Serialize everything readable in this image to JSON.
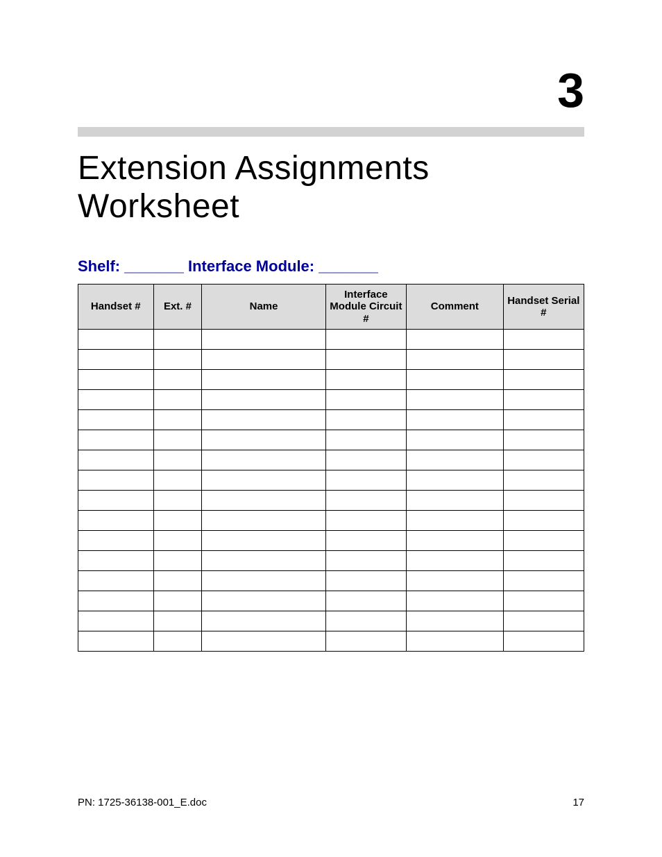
{
  "chapter_number": "3",
  "title": "Extension Assignments Worksheet",
  "subhead": "Shelf: _______   Interface Module: _______",
  "table": {
    "headers": [
      "Handset #",
      "Ext. #",
      "Name",
      "Interface Module Circuit #",
      "Comment",
      "Handset Serial #"
    ],
    "empty_row_count": 16
  },
  "footer": {
    "left": "PN: 1725-36138-001_E.doc",
    "right": "17"
  }
}
